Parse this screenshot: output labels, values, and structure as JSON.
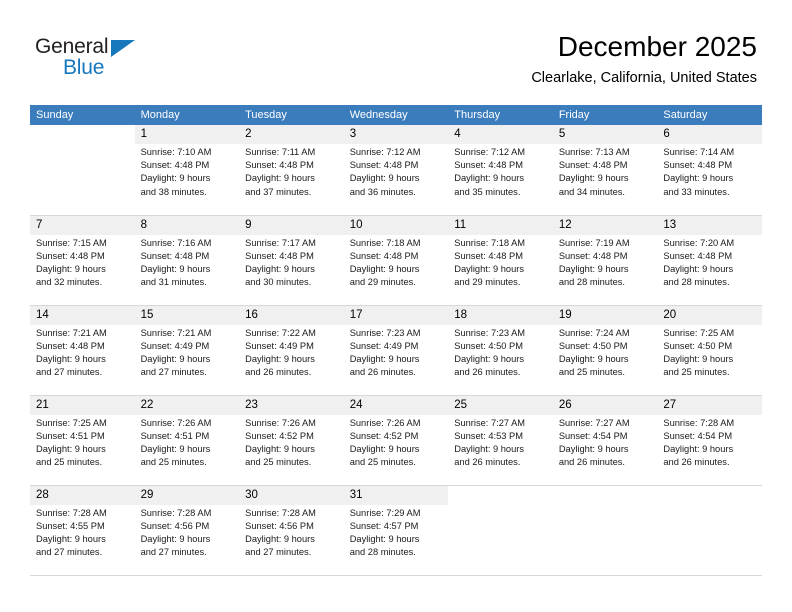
{
  "brand": {
    "name_dark": "General",
    "name_blue": "Blue",
    "accent_color": "#1878be",
    "header_color": "#3b7cbd"
  },
  "header": {
    "month_title": "December 2025",
    "location": "Clearlake, California, United States"
  },
  "calendar": {
    "weekdays": [
      "Sunday",
      "Monday",
      "Tuesday",
      "Wednesday",
      "Thursday",
      "Friday",
      "Saturday"
    ],
    "weeks": [
      [
        {
          "day": "",
          "sunrise": "",
          "sunset": "",
          "daylight_line1": "",
          "daylight_line2": ""
        },
        {
          "day": "1",
          "sunrise": "Sunrise: 7:10 AM",
          "sunset": "Sunset: 4:48 PM",
          "daylight_line1": "Daylight: 9 hours",
          "daylight_line2": "and 38 minutes."
        },
        {
          "day": "2",
          "sunrise": "Sunrise: 7:11 AM",
          "sunset": "Sunset: 4:48 PM",
          "daylight_line1": "Daylight: 9 hours",
          "daylight_line2": "and 37 minutes."
        },
        {
          "day": "3",
          "sunrise": "Sunrise: 7:12 AM",
          "sunset": "Sunset: 4:48 PM",
          "daylight_line1": "Daylight: 9 hours",
          "daylight_line2": "and 36 minutes."
        },
        {
          "day": "4",
          "sunrise": "Sunrise: 7:12 AM",
          "sunset": "Sunset: 4:48 PM",
          "daylight_line1": "Daylight: 9 hours",
          "daylight_line2": "and 35 minutes."
        },
        {
          "day": "5",
          "sunrise": "Sunrise: 7:13 AM",
          "sunset": "Sunset: 4:48 PM",
          "daylight_line1": "Daylight: 9 hours",
          "daylight_line2": "and 34 minutes."
        },
        {
          "day": "6",
          "sunrise": "Sunrise: 7:14 AM",
          "sunset": "Sunset: 4:48 PM",
          "daylight_line1": "Daylight: 9 hours",
          "daylight_line2": "and 33 minutes."
        }
      ],
      [
        {
          "day": "7",
          "sunrise": "Sunrise: 7:15 AM",
          "sunset": "Sunset: 4:48 PM",
          "daylight_line1": "Daylight: 9 hours",
          "daylight_line2": "and 32 minutes."
        },
        {
          "day": "8",
          "sunrise": "Sunrise: 7:16 AM",
          "sunset": "Sunset: 4:48 PM",
          "daylight_line1": "Daylight: 9 hours",
          "daylight_line2": "and 31 minutes."
        },
        {
          "day": "9",
          "sunrise": "Sunrise: 7:17 AM",
          "sunset": "Sunset: 4:48 PM",
          "daylight_line1": "Daylight: 9 hours",
          "daylight_line2": "and 30 minutes."
        },
        {
          "day": "10",
          "sunrise": "Sunrise: 7:18 AM",
          "sunset": "Sunset: 4:48 PM",
          "daylight_line1": "Daylight: 9 hours",
          "daylight_line2": "and 29 minutes."
        },
        {
          "day": "11",
          "sunrise": "Sunrise: 7:18 AM",
          "sunset": "Sunset: 4:48 PM",
          "daylight_line1": "Daylight: 9 hours",
          "daylight_line2": "and 29 minutes."
        },
        {
          "day": "12",
          "sunrise": "Sunrise: 7:19 AM",
          "sunset": "Sunset: 4:48 PM",
          "daylight_line1": "Daylight: 9 hours",
          "daylight_line2": "and 28 minutes."
        },
        {
          "day": "13",
          "sunrise": "Sunrise: 7:20 AM",
          "sunset": "Sunset: 4:48 PM",
          "daylight_line1": "Daylight: 9 hours",
          "daylight_line2": "and 28 minutes."
        }
      ],
      [
        {
          "day": "14",
          "sunrise": "Sunrise: 7:21 AM",
          "sunset": "Sunset: 4:48 PM",
          "daylight_line1": "Daylight: 9 hours",
          "daylight_line2": "and 27 minutes."
        },
        {
          "day": "15",
          "sunrise": "Sunrise: 7:21 AM",
          "sunset": "Sunset: 4:49 PM",
          "daylight_line1": "Daylight: 9 hours",
          "daylight_line2": "and 27 minutes."
        },
        {
          "day": "16",
          "sunrise": "Sunrise: 7:22 AM",
          "sunset": "Sunset: 4:49 PM",
          "daylight_line1": "Daylight: 9 hours",
          "daylight_line2": "and 26 minutes."
        },
        {
          "day": "17",
          "sunrise": "Sunrise: 7:23 AM",
          "sunset": "Sunset: 4:49 PM",
          "daylight_line1": "Daylight: 9 hours",
          "daylight_line2": "and 26 minutes."
        },
        {
          "day": "18",
          "sunrise": "Sunrise: 7:23 AM",
          "sunset": "Sunset: 4:50 PM",
          "daylight_line1": "Daylight: 9 hours",
          "daylight_line2": "and 26 minutes."
        },
        {
          "day": "19",
          "sunrise": "Sunrise: 7:24 AM",
          "sunset": "Sunset: 4:50 PM",
          "daylight_line1": "Daylight: 9 hours",
          "daylight_line2": "and 25 minutes."
        },
        {
          "day": "20",
          "sunrise": "Sunrise: 7:25 AM",
          "sunset": "Sunset: 4:50 PM",
          "daylight_line1": "Daylight: 9 hours",
          "daylight_line2": "and 25 minutes."
        }
      ],
      [
        {
          "day": "21",
          "sunrise": "Sunrise: 7:25 AM",
          "sunset": "Sunset: 4:51 PM",
          "daylight_line1": "Daylight: 9 hours",
          "daylight_line2": "and 25 minutes."
        },
        {
          "day": "22",
          "sunrise": "Sunrise: 7:26 AM",
          "sunset": "Sunset: 4:51 PM",
          "daylight_line1": "Daylight: 9 hours",
          "daylight_line2": "and 25 minutes."
        },
        {
          "day": "23",
          "sunrise": "Sunrise: 7:26 AM",
          "sunset": "Sunset: 4:52 PM",
          "daylight_line1": "Daylight: 9 hours",
          "daylight_line2": "and 25 minutes."
        },
        {
          "day": "24",
          "sunrise": "Sunrise: 7:26 AM",
          "sunset": "Sunset: 4:52 PM",
          "daylight_line1": "Daylight: 9 hours",
          "daylight_line2": "and 25 minutes."
        },
        {
          "day": "25",
          "sunrise": "Sunrise: 7:27 AM",
          "sunset": "Sunset: 4:53 PM",
          "daylight_line1": "Daylight: 9 hours",
          "daylight_line2": "and 26 minutes."
        },
        {
          "day": "26",
          "sunrise": "Sunrise: 7:27 AM",
          "sunset": "Sunset: 4:54 PM",
          "daylight_line1": "Daylight: 9 hours",
          "daylight_line2": "and 26 minutes."
        },
        {
          "day": "27",
          "sunrise": "Sunrise: 7:28 AM",
          "sunset": "Sunset: 4:54 PM",
          "daylight_line1": "Daylight: 9 hours",
          "daylight_line2": "and 26 minutes."
        }
      ],
      [
        {
          "day": "28",
          "sunrise": "Sunrise: 7:28 AM",
          "sunset": "Sunset: 4:55 PM",
          "daylight_line1": "Daylight: 9 hours",
          "daylight_line2": "and 27 minutes."
        },
        {
          "day": "29",
          "sunrise": "Sunrise: 7:28 AM",
          "sunset": "Sunset: 4:56 PM",
          "daylight_line1": "Daylight: 9 hours",
          "daylight_line2": "and 27 minutes."
        },
        {
          "day": "30",
          "sunrise": "Sunrise: 7:28 AM",
          "sunset": "Sunset: 4:56 PM",
          "daylight_line1": "Daylight: 9 hours",
          "daylight_line2": "and 27 minutes."
        },
        {
          "day": "31",
          "sunrise": "Sunrise: 7:29 AM",
          "sunset": "Sunset: 4:57 PM",
          "daylight_line1": "Daylight: 9 hours",
          "daylight_line2": "and 28 minutes."
        },
        {
          "day": "",
          "sunrise": "",
          "sunset": "",
          "daylight_line1": "",
          "daylight_line2": ""
        },
        {
          "day": "",
          "sunrise": "",
          "sunset": "",
          "daylight_line1": "",
          "daylight_line2": ""
        },
        {
          "day": "",
          "sunrise": "",
          "sunset": "",
          "daylight_line1": "",
          "daylight_line2": ""
        }
      ]
    ]
  }
}
